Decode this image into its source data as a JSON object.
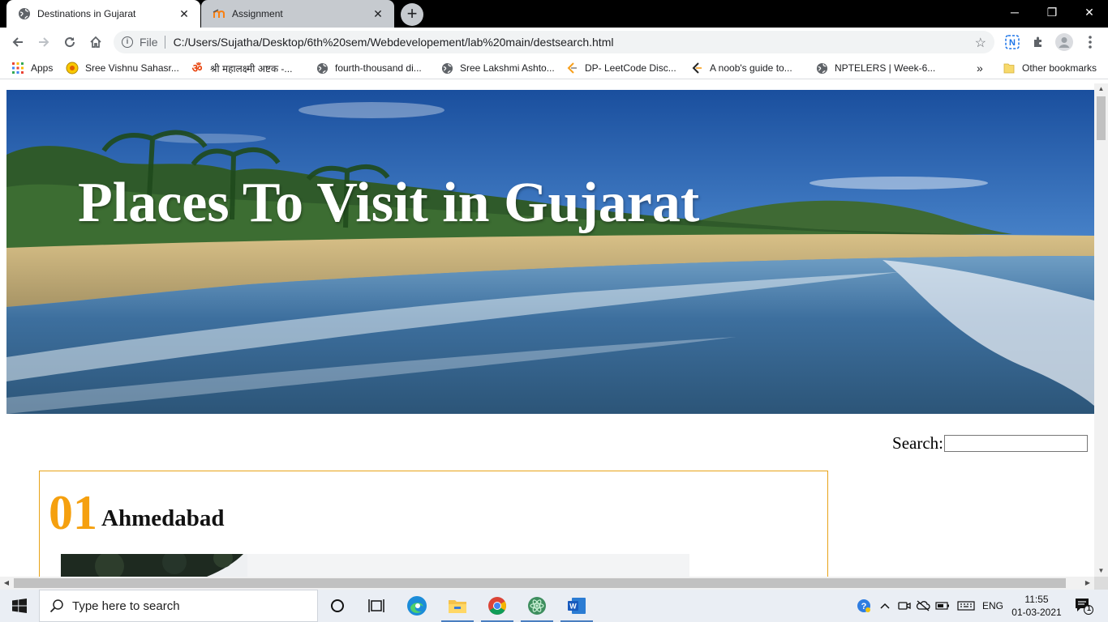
{
  "browser": {
    "tabs": [
      {
        "title": "Destinations in Gujarat",
        "active": true,
        "icon": "globe-icon"
      },
      {
        "title": "Assignment",
        "active": false,
        "icon": "moodle-icon"
      }
    ],
    "address": {
      "scheme_label": "File",
      "url": "C:/Users/Sujatha/Desktop/6th%20sem/Webdevelopement/lab%20main/destsearch.html"
    },
    "extensions": [
      "n-extension-icon",
      "puzzle-icon",
      "profile-icon",
      "more-vert-icon"
    ]
  },
  "bookmarks": {
    "items": [
      {
        "label": "Apps",
        "icon": "apps-grid-icon"
      },
      {
        "label": "Sree Vishnu Sahasr...",
        "icon": "sun-icon"
      },
      {
        "label": "श्री महालक्ष्मी अष्टक -...",
        "icon": "om-icon"
      },
      {
        "label": "fourth-thousand di...",
        "icon": "globe-icon"
      },
      {
        "label": "Sree Lakshmi Ashto...",
        "icon": "globe-icon"
      },
      {
        "label": "DP- LeetCode Disc...",
        "icon": "leetcode-icon"
      },
      {
        "label": "A noob's guide to...",
        "icon": "leetcode-icon"
      },
      {
        "label": "NPTELERS | Week-6...",
        "icon": "globe-icon"
      }
    ],
    "overflow": "»",
    "other": "Other bookmarks"
  },
  "page": {
    "hero_title": "Places To Visit in Gujarat",
    "search_label": "Search:",
    "search_value": "",
    "destinations": [
      {
        "number": "01",
        "name": "Ahmedabad"
      }
    ],
    "colors": {
      "accent": "#f5a00f",
      "card_border": "#e8a317"
    }
  },
  "taskbar": {
    "search_placeholder": "Type here to search",
    "apps": [
      "cortana-icon",
      "task-view-icon",
      "edge-icon",
      "file-explorer-icon",
      "chrome-icon",
      "atom-icon",
      "word-icon"
    ],
    "language": "ENG",
    "time": "11:55",
    "date": "01-03-2021",
    "notification_count": "1"
  }
}
